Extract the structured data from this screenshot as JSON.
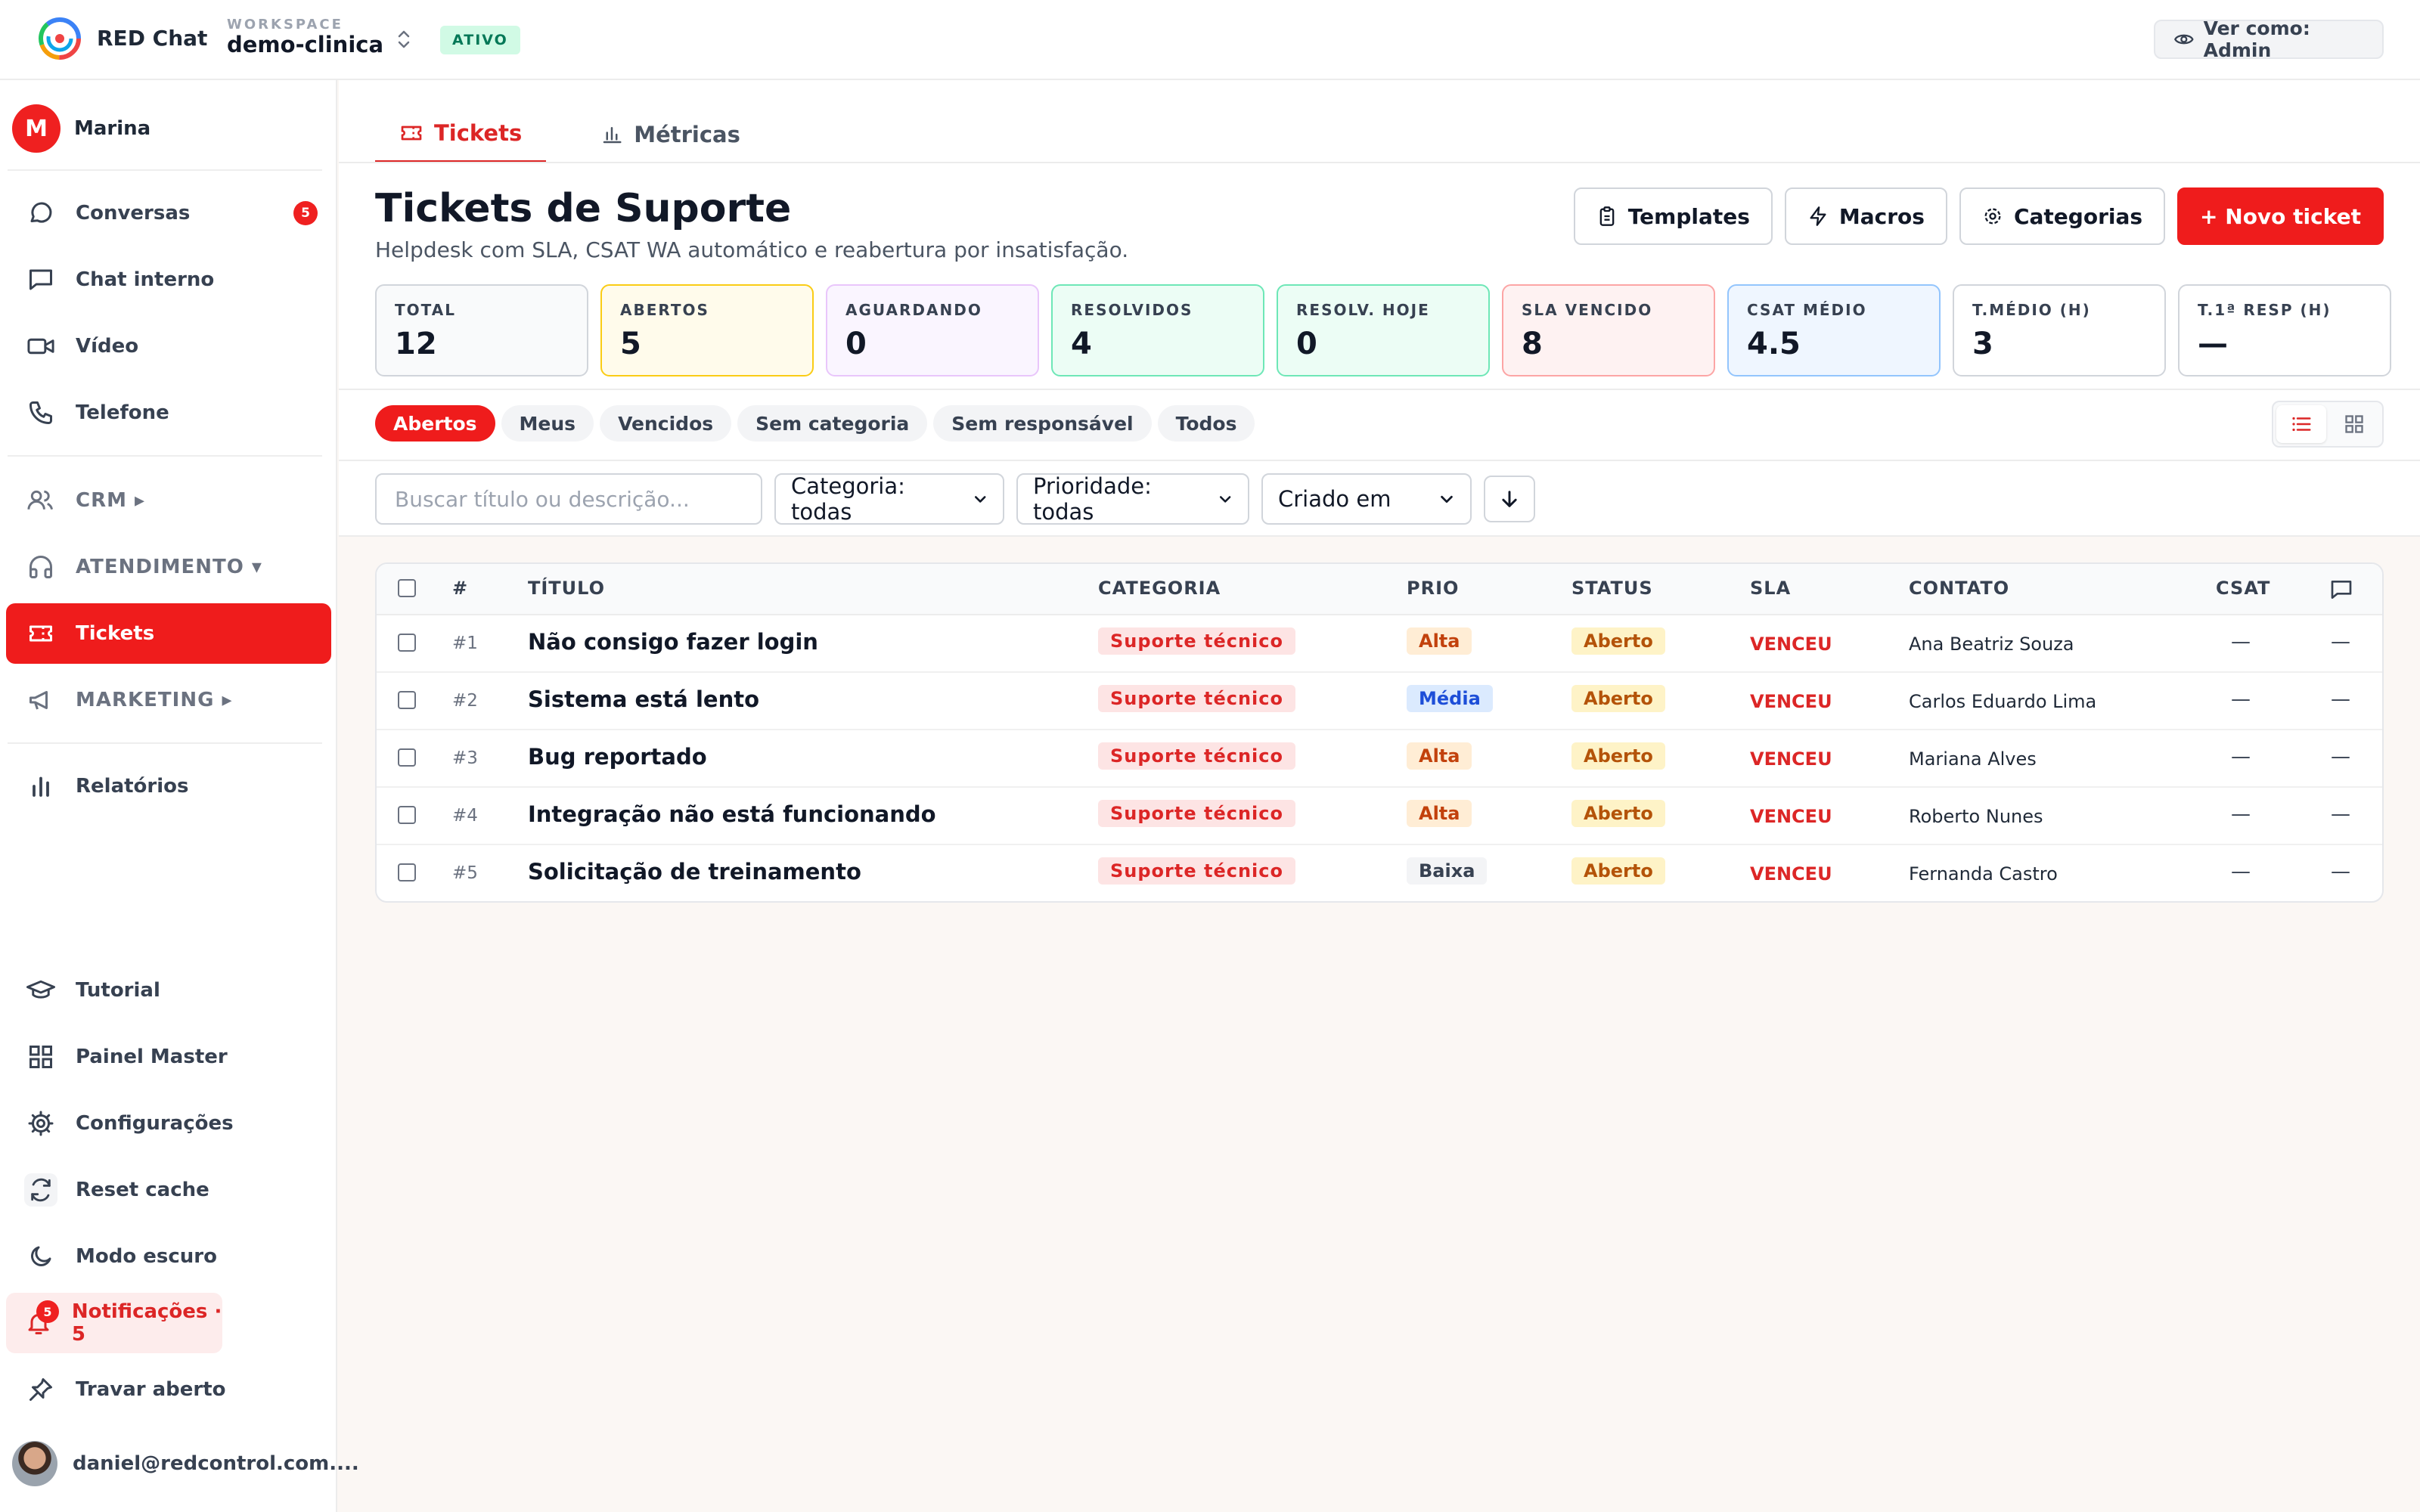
{
  "topbar": {
    "brand": "RED Chat",
    "workspace_label": "WORKSPACE",
    "workspace_name": "demo-clinica",
    "status_badge": "ATIVO",
    "view_as": "Ver como: Admin"
  },
  "sidebar": {
    "user_initial": "M",
    "user_name": "Marina",
    "items": [
      {
        "label": "Conversas",
        "count": "5"
      },
      {
        "label": "Chat interno"
      },
      {
        "label": "Vídeo"
      },
      {
        "label": "Telefone"
      },
      {
        "label": "CRM ▸"
      },
      {
        "label": "ATENDIMENTO ▾"
      },
      {
        "label": "Tickets"
      },
      {
        "label": "MARKETING ▸"
      },
      {
        "label": "Relatórios"
      }
    ],
    "bottom_items": [
      {
        "label": "Tutorial"
      },
      {
        "label": "Painel Master"
      },
      {
        "label": "Configurações"
      },
      {
        "label": "Reset cache"
      },
      {
        "label": "Modo escuro"
      },
      {
        "label": "Notificações · 5",
        "count": "5"
      },
      {
        "label": "Travar aberto"
      }
    ],
    "email": "daniel@redcontrol.com...."
  },
  "tabs": [
    {
      "label": "Tickets",
      "active": true
    },
    {
      "label": "Métricas",
      "active": false
    }
  ],
  "header": {
    "title": "Tickets de Suporte",
    "subtitle": "Helpdesk com SLA, CSAT WA automático e reabertura por insatisfação.",
    "actions": [
      "Templates",
      "Macros",
      "Categorias",
      "+ Novo ticket"
    ]
  },
  "stats": [
    {
      "label": "TOTAL",
      "value": "12",
      "bg": "#f9fafb",
      "border": "#d1d5db"
    },
    {
      "label": "ABERTOS",
      "value": "5",
      "bg": "#fffbeb",
      "border": "#facc15"
    },
    {
      "label": "AGUARDANDO",
      "value": "0",
      "bg": "#faf5ff",
      "border": "#e9c6fb"
    },
    {
      "label": "RESOLVIDOS",
      "value": "4",
      "bg": "#ecfdf5",
      "border": "#6ee7b7"
    },
    {
      "label": "RESOLV. HOJE",
      "value": "0",
      "bg": "#ecfdf5",
      "border": "#6ee7b7"
    },
    {
      "label": "SLA VENCIDO",
      "value": "8",
      "bg": "#fef2f2",
      "border": "#fca5a5"
    },
    {
      "label": "CSAT MÉDIO",
      "value": "4.5",
      "bg": "#eff6ff",
      "border": "#93c5fd"
    },
    {
      "label": "T.MÉDIO (H)",
      "value": "3",
      "bg": "#ffffff",
      "border": "#d1d5db"
    },
    {
      "label": "T.1ª RESP (H)",
      "value": "—",
      "bg": "#ffffff",
      "border": "#d1d5db"
    }
  ],
  "chips": [
    {
      "label": "Abertos",
      "active": true
    },
    {
      "label": "Meus"
    },
    {
      "label": "Vencidos"
    },
    {
      "label": "Sem categoria"
    },
    {
      "label": "Sem responsável"
    },
    {
      "label": "Todos"
    }
  ],
  "filters": {
    "search_placeholder": "Buscar título ou descrição...",
    "category": "Categoria: todas",
    "priority": "Prioridade: todas",
    "sort": "Criado em"
  },
  "table": {
    "columns": [
      "#",
      "TÍTULO",
      "CATEGORIA",
      "PRIO",
      "STATUS",
      "SLA",
      "CONTATO",
      "CSAT"
    ],
    "rows": [
      {
        "num": "#1",
        "title": "Não consigo fazer login",
        "category": "Suporte técnico",
        "prio": "Alta",
        "status": "Aberto",
        "sla": "VENCEU",
        "contact": "Ana Beatriz Souza",
        "csat": "—",
        "msgs": "—"
      },
      {
        "num": "#2",
        "title": "Sistema está lento",
        "category": "Suporte técnico",
        "prio": "Média",
        "status": "Aberto",
        "sla": "VENCEU",
        "contact": "Carlos Eduardo Lima",
        "csat": "—",
        "msgs": "—"
      },
      {
        "num": "#3",
        "title": "Bug reportado",
        "category": "Suporte técnico",
        "prio": "Alta",
        "status": "Aberto",
        "sla": "VENCEU",
        "contact": "Mariana Alves",
        "csat": "—",
        "msgs": "—"
      },
      {
        "num": "#4",
        "title": "Integração não está funcionando",
        "category": "Suporte técnico",
        "prio": "Alta",
        "status": "Aberto",
        "sla": "VENCEU",
        "contact": "Roberto Nunes",
        "csat": "—",
        "msgs": "—"
      },
      {
        "num": "#5",
        "title": "Solicitação de treinamento",
        "category": "Suporte técnico",
        "prio": "Baixa",
        "status": "Aberto",
        "sla": "VENCEU",
        "contact": "Fernanda Castro",
        "csat": "—",
        "msgs": "—"
      }
    ]
  }
}
